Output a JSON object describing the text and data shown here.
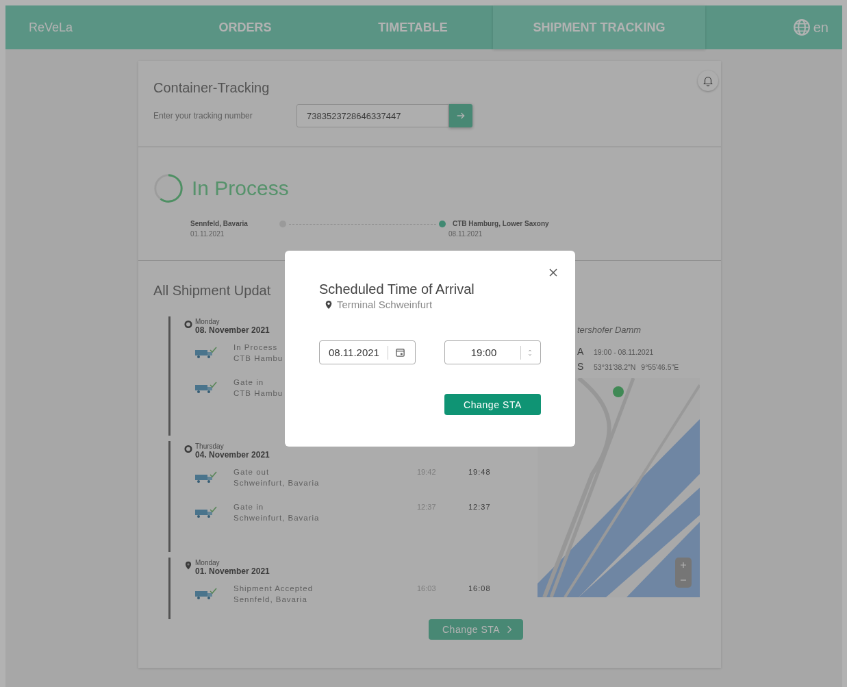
{
  "nav": {
    "logo": "ReVeLa",
    "tabs": [
      {
        "label": "ORDERS",
        "selected": false
      },
      {
        "label": "TIMETABLE",
        "selected": false
      },
      {
        "label": "SHIPMENT TRACKING",
        "selected": true
      }
    ],
    "language": "en"
  },
  "tracking": {
    "title": "Container-Tracking",
    "label": "Enter your tracking number",
    "value": "7383523728646337447"
  },
  "status": {
    "label": "In Process",
    "level": 0.6,
    "origin": {
      "place": "Sennfeld, Bavaria",
      "date": "01.11.2021",
      "reached": false
    },
    "destination": {
      "place": "CTB Hamburg, Lower Saxony",
      "date": "08.11.2021",
      "reached": true
    }
  },
  "updates": {
    "title": "All Shipment Updat",
    "days": [
      {
        "kind": "circle",
        "weekday": "Monday",
        "date": "08. November 2021",
        "events": [
          {
            "title": "In Process",
            "place": "CTB Hambu"
          },
          {
            "title": "Gate in",
            "place": "CTB Hambu"
          }
        ]
      },
      {
        "kind": "circle",
        "weekday": "Thursday",
        "date": "04. November 2021",
        "events": [
          {
            "title": "Gate out",
            "place": "Schweinfurt, Bavaria",
            "planned": "19:42",
            "actual": "19:48"
          },
          {
            "title": "Gate in",
            "place": "Schweinfurt, Bavaria",
            "planned": "12:37",
            "actual": "12:37"
          }
        ]
      },
      {
        "kind": "pin",
        "weekday": "Monday",
        "date": "01. November 2021",
        "events": [
          {
            "title": "Shipment Accepted",
            "place": "Sennfeld, Bavaria",
            "planned": "16:03",
            "actual": "16:08"
          }
        ]
      }
    ],
    "map": {
      "place": "tershofer Damm",
      "rows": [
        {
          "key": "A",
          "values": [
            "19:00 - 08.11.2021"
          ]
        },
        {
          "key": "S",
          "values": [
            "53°31'38.2\"N",
            "9°55'46.5\"E"
          ]
        }
      ]
    },
    "button": "Change STA"
  },
  "modal": {
    "title": "Scheduled Time of Arrival",
    "location": "Terminal Schweinfurt",
    "date": "08.11.2021",
    "time": "19:00",
    "button": "Change STA"
  }
}
